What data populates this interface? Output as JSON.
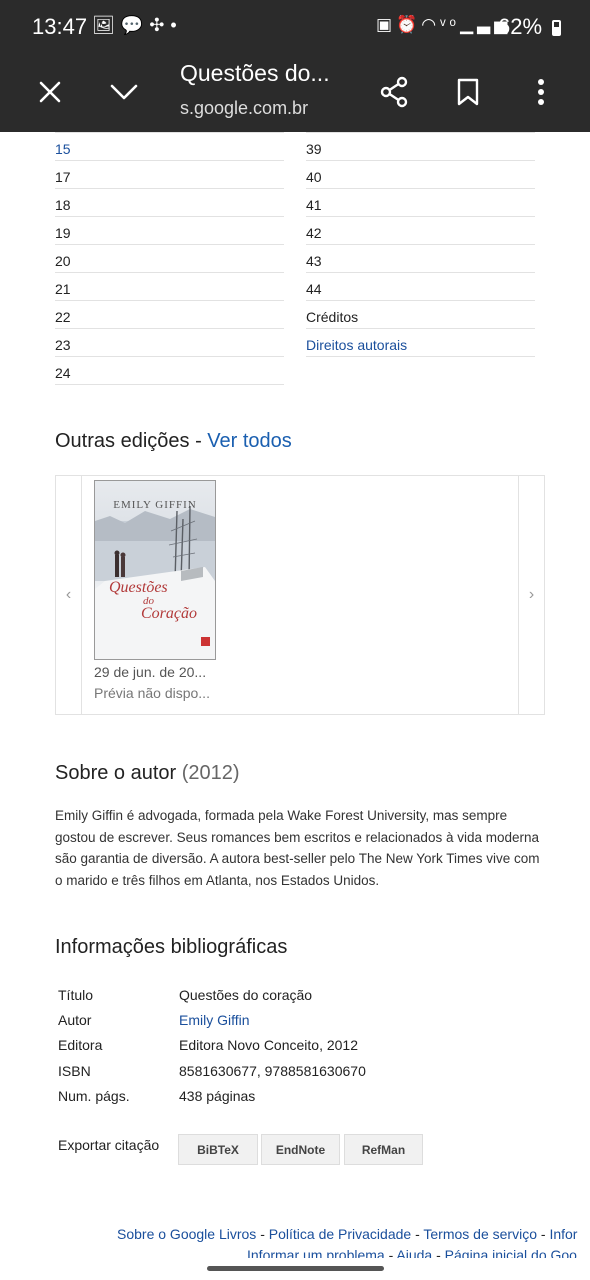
{
  "status_bar": {
    "time": "13:47",
    "left_icons": [
      "image-icon",
      "chat-icon",
      "pinwheel-icon",
      "dot-icon"
    ],
    "right_icons": [
      "nfc-icon",
      "alarm-icon",
      "wifi-icon",
      "volte-icon",
      "signal-icon"
    ],
    "battery": "62%"
  },
  "toolbar": {
    "title": "Questões do...",
    "url": "s.google.com.br"
  },
  "toc": {
    "left": [
      {
        "label": "15",
        "link": true
      },
      {
        "label": "17",
        "link": false
      },
      {
        "label": "18",
        "link": false
      },
      {
        "label": "19",
        "link": false
      },
      {
        "label": "20",
        "link": false
      },
      {
        "label": "21",
        "link": false
      },
      {
        "label": "22",
        "link": false
      },
      {
        "label": "23",
        "link": false
      },
      {
        "label": "24",
        "link": false
      }
    ],
    "right": [
      {
        "label": "39",
        "link": false
      },
      {
        "label": "40",
        "link": false
      },
      {
        "label": "41",
        "link": false
      },
      {
        "label": "42",
        "link": false
      },
      {
        "label": "43",
        "link": false
      },
      {
        "label": "44",
        "link": false
      },
      {
        "label": "Créditos",
        "link": false
      },
      {
        "label": "Direitos autorais",
        "link": true
      }
    ]
  },
  "editions": {
    "heading": "Outras edições -",
    "see_all": "Ver todos",
    "prev_arrow": "‹",
    "next_arrow": "›",
    "items": [
      {
        "cover_author": "EMILY GIFFIN",
        "cover_title_1": "Questões",
        "cover_title_2": "do",
        "cover_title_3": "Coração",
        "date": "29 de jun. de 20...",
        "preview": "Prévia não dispo..."
      }
    ]
  },
  "about_author": {
    "heading": "Sobre o autor",
    "year": "(2012)",
    "bio": "Emily Giffin é advogada, formada pela Wake Forest University, mas sempre gostou de escrever. Seus romances bem escritos e relacionados à vida moderna são garantia de diversão. A autora best-seller pelo The New York Times vive com o marido e três filhos em Atlanta, nos Estados Unidos."
  },
  "bibliography": {
    "heading": "Informações bibliográficas",
    "rows": [
      {
        "key": "Título",
        "value": "Questões do coração",
        "link": false
      },
      {
        "key": "Autor",
        "value": "Emily Giffin",
        "link": true
      },
      {
        "key": "Editora",
        "value": "Editora Novo Conceito, 2012",
        "link": false
      },
      {
        "key": "ISBN",
        "value": "8581630677, 9788581630670",
        "link": false
      },
      {
        "key": "Num. págs.",
        "value": "438 páginas",
        "link": false
      }
    ],
    "export_label": "Exportar citação",
    "export_buttons": [
      "BiBTeX",
      "EndNote",
      "RefMan"
    ]
  },
  "footer": {
    "line1": [
      "Sobre o Google Livros",
      "Política de Privacidade",
      "Termos de serviço",
      "Infor"
    ],
    "line2": [
      "Informar um problema",
      "Ajuda",
      "Página inicial do Goo"
    ],
    "separator": " - "
  },
  "colors": {
    "chrome_bg": "#2b2b2b",
    "link": "#1a4f9c",
    "accent_link": "#1a5fb0"
  }
}
